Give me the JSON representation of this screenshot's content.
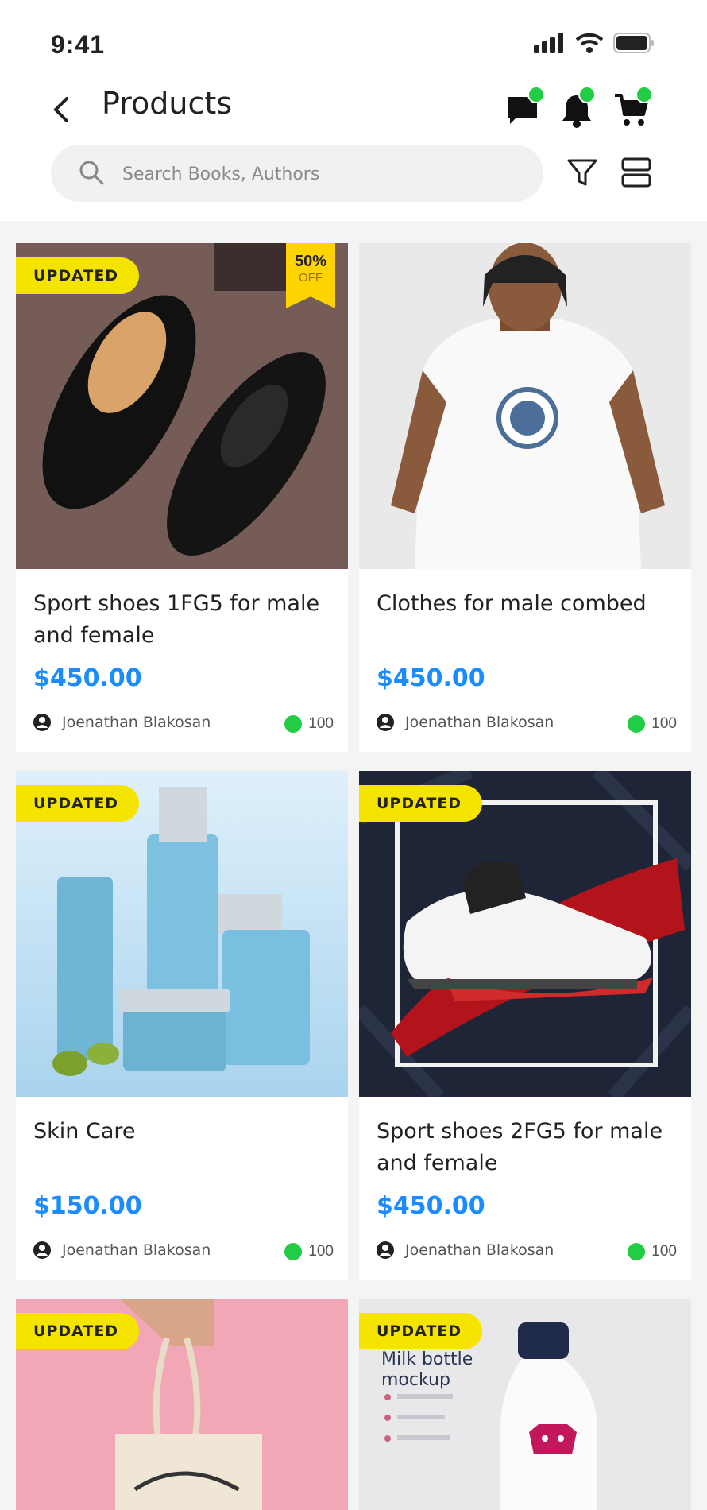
{
  "status": {
    "time": "9:41"
  },
  "header": {
    "title": "Products"
  },
  "search": {
    "placeholder": "Search Books, Authors"
  },
  "products": [
    {
      "name": "Sport shoes 1FG5 for male and female",
      "price": "$450.00",
      "seller": "Joenathan Blakosan",
      "stock": "100",
      "badge": "UPDATED",
      "discount_pct": "50%",
      "discount_label": "OFF"
    },
    {
      "name": "Clothes for male combed",
      "price": "$450.00",
      "seller": "Joenathan Blakosan",
      "stock": "100"
    },
    {
      "name": "Skin Care",
      "price": "$150.00",
      "seller": "Joenathan Blakosan",
      "stock": "100",
      "badge": "UPDATED"
    },
    {
      "name": "Sport shoes 2FG5 for male and female",
      "price": "$450.00",
      "seller": "Joenathan Blakosan",
      "stock": "100",
      "badge": "UPDATED"
    },
    {
      "badge": "UPDATED"
    },
    {
      "badge": "UPDATED",
      "image_text": {
        "title1": "Milk bottle",
        "title2": "mockup"
      }
    }
  ],
  "colors": {
    "accent": "#1a8cff",
    "badge": "#f5e400",
    "status_dot": "#22cc44"
  },
  "icons": [
    "back-icon",
    "chat-icon",
    "bell-icon",
    "cart-icon",
    "search-icon",
    "filter-icon",
    "layout-toggle-icon",
    "user-icon"
  ]
}
